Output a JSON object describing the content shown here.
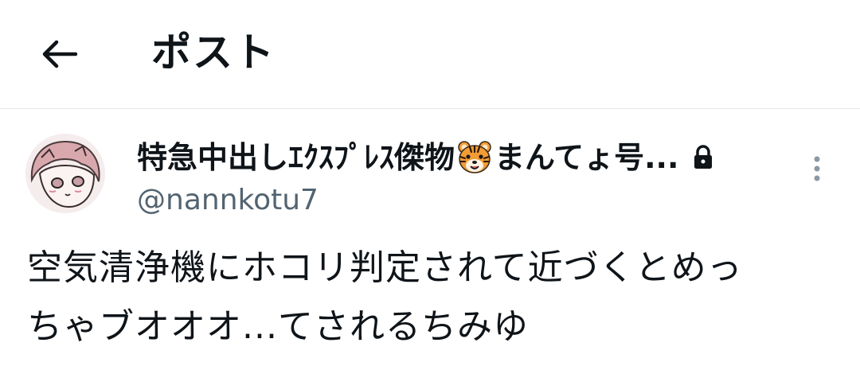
{
  "header": {
    "title": "ポスト",
    "back_icon": "arrow-left-icon"
  },
  "post": {
    "author": {
      "display_name_before_emoji": "特急中出しｴｸｽﾌﾟﾚｽ傑物",
      "emoji_icon": "tiger-face-icon",
      "display_name_after_emoji": "まんてょ号...",
      "protected_icon": "lock-icon",
      "handle": "@nannkotu7"
    },
    "more_icon": "more-vertical-icon",
    "text_line1": "空気清浄機にホコリ判定されて近づくとめっ",
    "text_line2": "ちゃブオオオ...てされるちみゆ"
  },
  "colors": {
    "text_primary": "#0f1419",
    "text_secondary": "#536471",
    "divider": "#e6e6e6",
    "tiger_orange": "#f39c34"
  }
}
